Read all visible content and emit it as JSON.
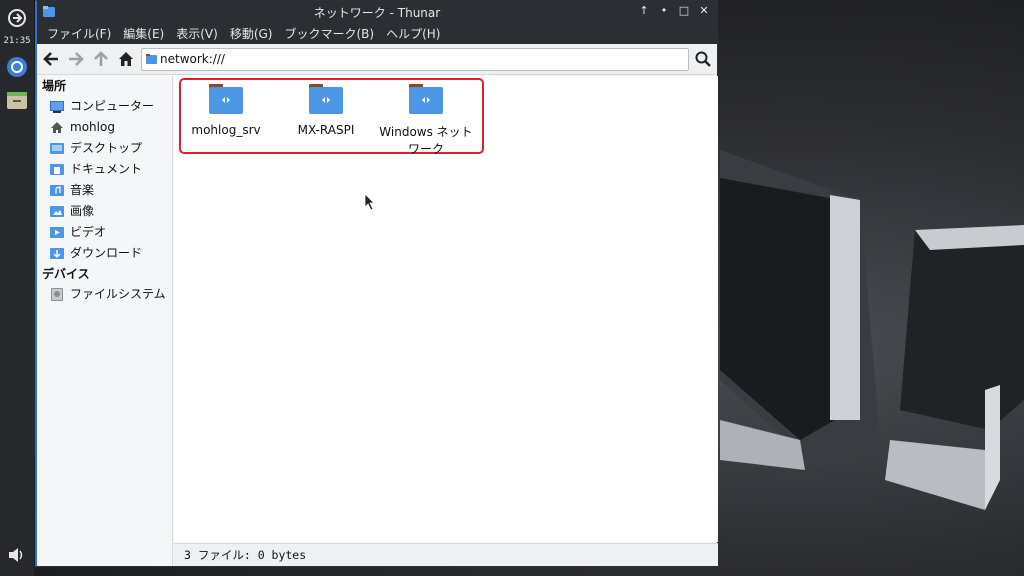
{
  "panel": {
    "clock": "21:35"
  },
  "window": {
    "title": "ネットワーク - Thunar",
    "controls": [
      "↑",
      "•",
      "□",
      "✕"
    ]
  },
  "menubar": {
    "items": [
      "ファイル(F)",
      "編集(E)",
      "表示(V)",
      "移動(G)",
      "ブックマーク(B)",
      "ヘルプ(H)"
    ]
  },
  "toolbar": {
    "location_value": "network:///"
  },
  "sidebar": {
    "places_heading": "場所",
    "places": [
      "コンピューター",
      "mohlog",
      "デスクトップ",
      "ドキュメント",
      "音楽",
      "画像",
      "ビデオ",
      "ダウンロード"
    ],
    "devices_heading": "デバイス",
    "devices": [
      "ファイルシステム"
    ]
  },
  "content": {
    "items": [
      {
        "name": "mohlog_srv",
        "name2": ""
      },
      {
        "name": "MX-RASPI",
        "name2": ""
      },
      {
        "name": "Windows ネット",
        "name2": "ワーク"
      }
    ]
  },
  "statusbar": {
    "text": "3 ファイル: 0 bytes"
  },
  "colors": {
    "accent": "#2f6fd6",
    "highlight_border": "#e0202a",
    "folder_blue": "#4b97e6",
    "folder_tab": "#8a4a1c",
    "titlebar": "#2b2e33"
  }
}
